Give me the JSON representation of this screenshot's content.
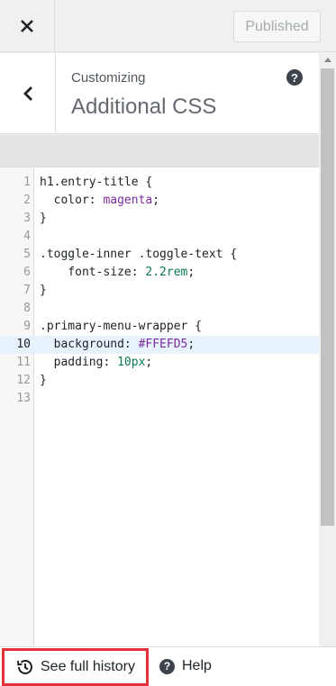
{
  "topbar": {
    "publish_label": "Published"
  },
  "header": {
    "eyebrow": "Customizing",
    "title": "Additional CSS",
    "help_glyph": "?"
  },
  "editor": {
    "active_line": 10,
    "lines": [
      {
        "n": "1",
        "segments": [
          {
            "t": "h1.entry-title {",
            "c": "plain"
          }
        ]
      },
      {
        "n": "2",
        "segments": [
          {
            "t": "  color: ",
            "c": "plain"
          },
          {
            "t": "magenta",
            "c": "val"
          },
          {
            "t": ";",
            "c": "plain"
          }
        ]
      },
      {
        "n": "3",
        "segments": [
          {
            "t": "}",
            "c": "plain"
          }
        ]
      },
      {
        "n": "4",
        "segments": []
      },
      {
        "n": "5",
        "segments": [
          {
            "t": ".toggle-inner .toggle-text {",
            "c": "plain"
          }
        ]
      },
      {
        "n": "6",
        "segments": [
          {
            "t": "    font-size: ",
            "c": "plain"
          },
          {
            "t": "2.2rem",
            "c": "num"
          },
          {
            "t": ";",
            "c": "plain"
          }
        ]
      },
      {
        "n": "7",
        "segments": [
          {
            "t": "}",
            "c": "plain"
          }
        ]
      },
      {
        "n": "8",
        "segments": []
      },
      {
        "n": "9",
        "segments": [
          {
            "t": ".primary-menu-wrapper {",
            "c": "plain"
          }
        ]
      },
      {
        "n": "10",
        "segments": [
          {
            "t": "  background: ",
            "c": "plain"
          },
          {
            "t": "#FFEFD5",
            "c": "val"
          },
          {
            "t": ";",
            "c": "plain"
          }
        ]
      },
      {
        "n": "11",
        "segments": [
          {
            "t": "  padding: ",
            "c": "plain"
          },
          {
            "t": "10px",
            "c": "num"
          },
          {
            "t": ";",
            "c": "plain"
          }
        ]
      },
      {
        "n": "12",
        "segments": [
          {
            "t": "}",
            "c": "plain"
          }
        ]
      },
      {
        "n": "13",
        "segments": []
      }
    ]
  },
  "footer": {
    "history_label": "See full history",
    "help_label": "Help",
    "help_glyph": "?"
  },
  "colors": {
    "highlight_border": "#e2313b",
    "active_line_bg": "#e8f2ff"
  }
}
